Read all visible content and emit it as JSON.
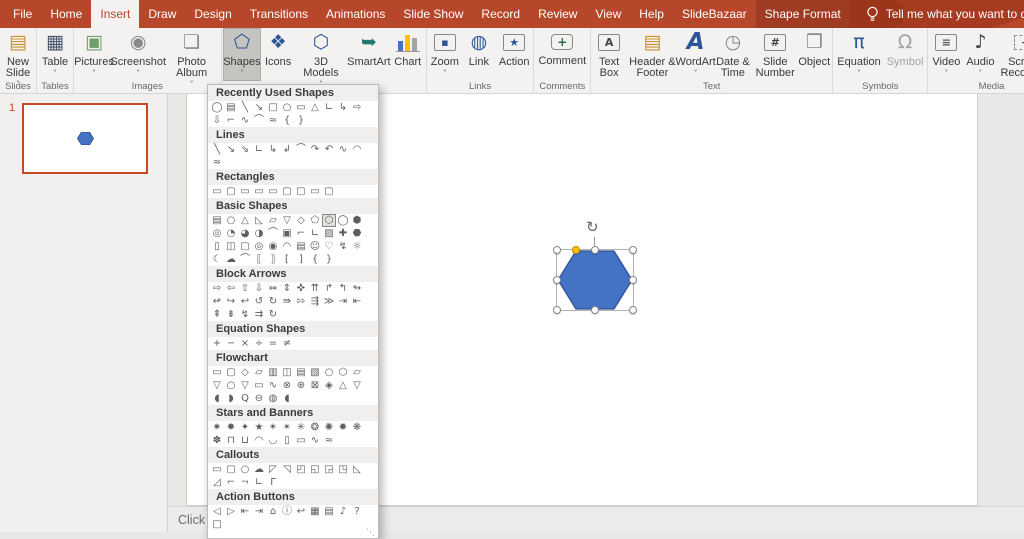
{
  "titlebar": {
    "tabs": [
      {
        "label": "File"
      },
      {
        "label": "Home"
      },
      {
        "label": "Insert",
        "state": "active"
      },
      {
        "label": "Draw"
      },
      {
        "label": "Design"
      },
      {
        "label": "Transitions"
      },
      {
        "label": "Animations"
      },
      {
        "label": "Slide Show"
      },
      {
        "label": "Record"
      },
      {
        "label": "Review"
      },
      {
        "label": "View"
      },
      {
        "label": "Help"
      },
      {
        "label": "SlideBazaar"
      },
      {
        "label": "Shape Format",
        "state": "contextual"
      }
    ],
    "tell_me": "Tell me what you want to do",
    "bar_color": "#b7472a",
    "contextual_tab_color": "#9e3b22"
  },
  "ribbon": {
    "groups": [
      {
        "label": "Slides",
        "buttons": [
          {
            "label": "New Slide",
            "glyph": "▤",
            "color": "#c9912f",
            "chevron": true
          }
        ]
      },
      {
        "label": "Tables",
        "buttons": [
          {
            "label": "Table",
            "glyph": "▦",
            "color": "#44546a",
            "chevron": true
          }
        ]
      },
      {
        "label": "Images",
        "buttons": [
          {
            "label": "Pictures",
            "glyph": "▣",
            "color": "#6f9f6a",
            "chevron": true
          },
          {
            "label": "Screenshot",
            "glyph": "◉",
            "color": "#8a8a8a",
            "chevron": true
          },
          {
            "label": "Photo Album",
            "glyph": "❏",
            "color": "#8a8a8a",
            "chevron": true
          }
        ]
      },
      {
        "label": "",
        "buttons": [
          {
            "label": "Shapes",
            "glyph": "⬠",
            "color": "#2b579a",
            "chevron": true,
            "selected": true
          },
          {
            "label": "Icons",
            "glyph": "❖",
            "color": "#2b579a"
          },
          {
            "label": "3D Models",
            "glyph": "⬡",
            "color": "#2b579a",
            "chevron": true
          },
          {
            "label": "SmartArt",
            "glyph": "➥",
            "color": "#1f7a6d"
          },
          {
            "label": "Chart",
            "style": "chart"
          }
        ]
      },
      {
        "label": "Links",
        "buttons": [
          {
            "label": "Zoom",
            "style": "box",
            "glyph": "▪",
            "color": "#2b579a",
            "chevron": true
          },
          {
            "label": "Link",
            "glyph": "◍",
            "color": "#2b579a"
          },
          {
            "label": "Action",
            "style": "box",
            "glyph": "★",
            "color": "#2b579a"
          }
        ]
      },
      {
        "label": "Comments",
        "buttons": [
          {
            "label": "Comment",
            "style": "bubble",
            "glyph": "+",
            "color": "#217346"
          }
        ]
      },
      {
        "label": "Text",
        "buttons": [
          {
            "label": "Text Box",
            "style": "box",
            "glyph": "A",
            "color": "#444444"
          },
          {
            "label": "Header & Footer",
            "glyph": "▤",
            "color": "#c9912f"
          },
          {
            "label": "WordArt",
            "style": "wordart",
            "glyph": "A",
            "color": "#2b579a",
            "chevron": true
          },
          {
            "label": "Date & Time",
            "glyph": "◷",
            "color": "#8a8a8a"
          },
          {
            "label": "Slide Number",
            "style": "box",
            "glyph": "#",
            "color": "#444444"
          },
          {
            "label": "Object",
            "glyph": "❒",
            "color": "#8a8a8a"
          }
        ]
      },
      {
        "label": "Symbols",
        "buttons": [
          {
            "label": "Equation",
            "glyph": "π",
            "color": "#2b579a",
            "chevron": true
          },
          {
            "label": "Symbol",
            "glyph": "Ω",
            "color": "#a6a4a2",
            "disabled": true
          }
        ]
      },
      {
        "label": "Media",
        "buttons": [
          {
            "label": "Video",
            "style": "box",
            "glyph": "≡",
            "color": "#555555",
            "chevron": true
          },
          {
            "label": "Audio",
            "glyph": "♪",
            "color": "#444444",
            "chevron": true
          },
          {
            "label": "Screen Recording",
            "style": "dashedbox",
            "glyph": "+",
            "color": "#2b579a"
          }
        ]
      }
    ]
  },
  "shapes_menu": {
    "sections": [
      {
        "title": "Recently Used Shapes",
        "glyphs": [
          "◯",
          "▤",
          "╲",
          "↘",
          "□",
          "○",
          "▭",
          "△",
          "∟",
          "↳",
          "⇨",
          "⇩",
          "⌐",
          "∿",
          "⌒",
          "≈",
          "{",
          "}"
        ]
      },
      {
        "title": "Lines",
        "glyphs": [
          "╲",
          "↘",
          "⇘",
          "∟",
          "↳",
          "↲",
          "⌒",
          "↷",
          "↶",
          "∿",
          "◠",
          "≈"
        ]
      },
      {
        "title": "Rectangles",
        "glyphs": [
          "▭",
          "▢",
          "▭",
          "▭",
          "▭",
          "▢",
          "▢",
          "▭",
          "▢"
        ]
      },
      {
        "title": "Basic Shapes",
        "highlight_index": 8,
        "glyphs": [
          "▤",
          "○",
          "△",
          "◺",
          "▱",
          "▽",
          "◇",
          "⬠",
          "⬡",
          "◯",
          "⬢",
          "◎",
          "◔",
          "◕",
          "◑",
          "⌒",
          "▣",
          "⌐",
          "∟",
          "▨",
          "✚",
          "⬣",
          "▯",
          "◫",
          "▢",
          "◎",
          "◉",
          "◠",
          "▤",
          "☺",
          "♡",
          "↯",
          "☼",
          "☾",
          "☁",
          "⌒",
          "⟦",
          "⟧",
          "[",
          "]",
          "{",
          "}"
        ]
      },
      {
        "title": "Block Arrows",
        "glyphs": [
          "⇨",
          "⇦",
          "⇧",
          "⇩",
          "⇔",
          "⇕",
          "✜",
          "⇈",
          "↱",
          "↰",
          "↬",
          "↫",
          "↪",
          "↩",
          "↺",
          "↻",
          "⇛",
          "⇰",
          "⇶",
          "≫",
          "⇥",
          "⇤",
          "⇞",
          "⇟",
          "↯",
          "⇉",
          "↻"
        ]
      },
      {
        "title": "Equation Shapes",
        "glyphs": [
          "+",
          "−",
          "×",
          "÷",
          "=",
          "≠"
        ]
      },
      {
        "title": "Flowchart",
        "glyphs": [
          "▭",
          "▢",
          "◇",
          "▱",
          "▥",
          "◫",
          "▤",
          "▧",
          "○",
          "⬡",
          "▱",
          "▽",
          "○",
          "▽",
          "▭",
          "∿",
          "⊗",
          "⊕",
          "⊠",
          "◈",
          "△",
          "▽",
          "◖",
          "◗",
          "Q",
          "⊖",
          "◍",
          "◖"
        ]
      },
      {
        "title": "Stars and Banners",
        "glyphs": [
          "✷",
          "✸",
          "✦",
          "★",
          "✶",
          "✴",
          "✳",
          "❂",
          "✺",
          "✹",
          "❋",
          "✽",
          "⊓",
          "⊔",
          "◠",
          "◡",
          "▯",
          "▭",
          "∿",
          "≈"
        ]
      },
      {
        "title": "Callouts",
        "glyphs": [
          "▭",
          "▢",
          "○",
          "☁",
          "◸",
          "◹",
          "◰",
          "◱",
          "◲",
          "◳",
          "◺",
          "◿",
          "⌐",
          "¬",
          "∟",
          "Γ"
        ]
      },
      {
        "title": "Action Buttons",
        "glyphs": [
          "◁",
          "▷",
          "⇤",
          "⇥",
          "⌂",
          "ⓘ",
          "↩",
          "▦",
          "▤",
          "♪",
          "?",
          "□"
        ]
      }
    ]
  },
  "slides_panel": {
    "number": "1"
  },
  "canvas": {
    "shape": "hexagon",
    "shape_fill": "#4472C4",
    "shape_stroke": "#2F528F",
    "adjustment_handle_color": "#ffc000"
  },
  "notes": {
    "placeholder": "Click to add notes"
  }
}
